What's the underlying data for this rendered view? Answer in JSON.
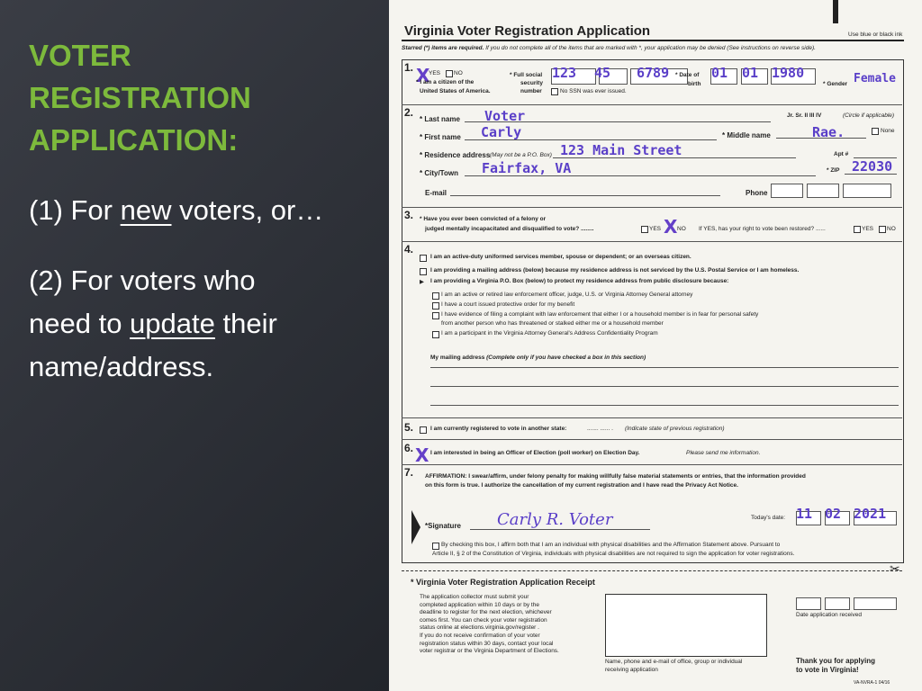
{
  "slide": {
    "title_lines": [
      "VOTER",
      "REGISTRATION",
      "APPLICATION:"
    ],
    "bullet1": {
      "pre": "(1) For ",
      "u": "new",
      "post": " voters, or…"
    },
    "bullet2": {
      "l1": "(2) For voters who",
      "l2pre": "need to ",
      "l2u": "update",
      "l2post": " their",
      "l3": "name/address."
    }
  },
  "form": {
    "title": "Virginia Voter Registration Application",
    "ink_note": "Use blue or black ink",
    "starred": "Starred (*) items are required.",
    "starred_note": "If you do not complete all of the items that are marked with *, your application may be denied  (See instructions on reverse side).",
    "s1": {
      "num": "1.",
      "yes": "YES",
      "no": "NO",
      "citizen1": "* I am a citizen of the",
      "citizen2": "United States of America.",
      "ssn1": "* Full social",
      "ssn2": "security",
      "ssn3": "number",
      "ssn_a": "123",
      "ssn_b": "45",
      "ssn_c": "6789",
      "no_ssn": "No SSN was ever issued.",
      "dob1": "* Date of",
      "dob2": "birth",
      "dob_m": "01",
      "dob_d": "01",
      "dob_y": "1980",
      "gender": "* Gender",
      "gender_val": "Female",
      "x_mark": "X"
    },
    "s2": {
      "num": "2.",
      "last": "* Last name",
      "last_val": "Voter",
      "suffix": "Jr.  Sr.  II  III  IV",
      "suffix_note": "(Circle if applicable)",
      "first": "* First name",
      "first_val": "Carly",
      "middle": "* Middle name",
      "middle_val": "Rae.",
      "none": "None",
      "res": "* Residence address",
      "res_note": "(May not be a P.O. Box)",
      "res_val": "123 Main Street",
      "apt": "Apt #",
      "city": "* City/Town",
      "city_val": "Fairfax, VA",
      "zip": "* ZIP",
      "zip_val": "22030",
      "email": "E-mail",
      "phone": "Phone"
    },
    "s3": {
      "num": "3.",
      "q1": "* Have you ever been convicted of a felony or",
      "q2": "judged mentally incapacitated and disqualified to vote? ........",
      "yes": "YES",
      "no": "NO",
      "x_mark": "X",
      "restored": "If YES, has your right to vote been restored? ......"
    },
    "s4": {
      "num": "4.",
      "l1": "I am an active-duty uniformed services member, spouse or dependent; or an overseas citizen.",
      "l2": "I am providing a mailing address (below) because my residence address is not serviced by the U.S. Postal Service or I am homeless.",
      "l3": "I am providing a Virginia P.O. Box (below) to protect my residence address from public disclosure because:",
      "s1": "I am an active or retired law enforcement officer, judge, U.S. or Virginia Attorney General attorney",
      "s2": "I have a court issued protective order for my benefit",
      "s3a": "I have evidence of filing a complaint with law enforcement that either I or a household member is in fear for personal safety",
      "s3b": "from another person who has threatened or stalked either me or a household member",
      "s4": "I am a participant in the Virginia Attorney General's Address Confidentiality Program",
      "mailing": "My mailing address",
      "mailing_note": "(Complete only if you have checked a box in this section)"
    },
    "s5": {
      "num": "5.",
      "text": "I am currently registered to vote in another state:",
      "dots": "....... ......  .",
      "note": "(Indicate state of previous registration)"
    },
    "s6": {
      "num": "6.",
      "x_mark": "X",
      "text": "I am interested in being an Officer of Election (poll worker) on Election Day.",
      "note": "Please send me information."
    },
    "s7": {
      "num": "7.",
      "aff1": "AFFIRMATION:  I swear/affirm, under felony penalty for making willfully false material statements or entries, that the information provided",
      "aff2": "on this form is true.  I authorize the cancellation of my current registration and I have read the Privacy Act Notice.",
      "sig": "*Signature",
      "sig_val": "Carly R. Voter",
      "today": "Today's date:",
      "date_m": "11",
      "date_d": "02",
      "date_y": "2021",
      "dis1": "By checking this box, I affirm both that I am an individual with physical disabilities and the Affirmation Statement above.  Pursuant to",
      "dis2": "Article II, § 2 of the Constitution of Virginia, individuals with physical disabilities are not required to sign the application for voter registrations."
    },
    "receipt": {
      "title": "* Virginia Voter Registration Application Receipt",
      "p": [
        "The application collector must submit your",
        "completed application within 10 days or by the",
        "deadline to register for the next election, whichever",
        "comes first.  You can check your voter registration",
        "status online at elections.virginia.gov/register .",
        "If you do not receive confirmation of your voter",
        "registration status within 30 days, contact your local",
        "voter registrar or the Virginia Department of Elections."
      ],
      "box1": "Name, phone and e-mail of office, group or individual",
      "box2": "receiving application",
      "date_label": "Date application received",
      "thanks1": "Thank you for applying",
      "thanks2": "to vote in Virginia!",
      "code": "VA-NVRA-1 04/16"
    },
    "scissors": "✂"
  }
}
